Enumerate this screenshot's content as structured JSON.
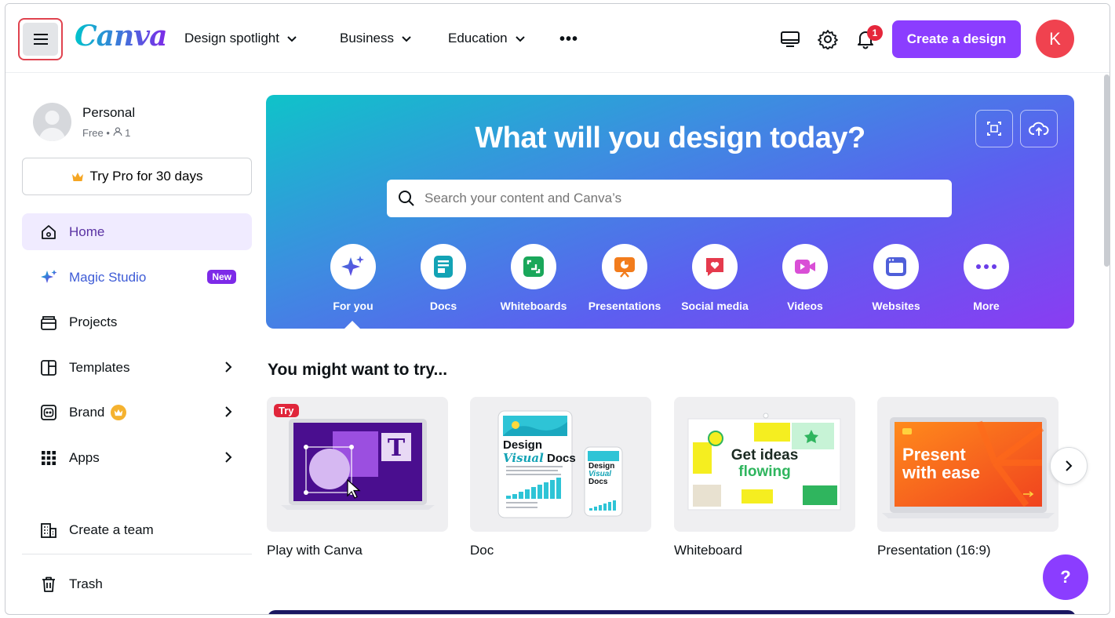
{
  "topbar": {
    "logo": "Canva",
    "nav": [
      {
        "label": "Design spotlight"
      },
      {
        "label": "Business"
      },
      {
        "label": "Education"
      }
    ],
    "notification_count": "1",
    "create_label": "Create a design",
    "avatar_initial": "K"
  },
  "sidebar": {
    "profile_name": "Personal",
    "profile_plan": "Free • ",
    "profile_members": "1",
    "try_pro_label": "Try Pro for 30 days",
    "items": [
      {
        "label": "Home"
      },
      {
        "label": "Magic Studio",
        "badge": "New"
      },
      {
        "label": "Projects"
      },
      {
        "label": "Templates"
      },
      {
        "label": "Brand"
      },
      {
        "label": "Apps"
      },
      {
        "label": "Create a team"
      },
      {
        "label": "Trash"
      }
    ]
  },
  "hero": {
    "title": "What will you design today?",
    "search_placeholder": "Search your content and Canva’s",
    "categories": [
      {
        "label": "For you"
      },
      {
        "label": "Docs"
      },
      {
        "label": "Whiteboards"
      },
      {
        "label": "Presentations"
      },
      {
        "label": "Social media"
      },
      {
        "label": "Videos"
      },
      {
        "label": "Websites"
      },
      {
        "label": "More"
      }
    ]
  },
  "suggestions": {
    "title": "You might want to try...",
    "cards": [
      {
        "label": "Play with Canva",
        "badge": "Try"
      },
      {
        "label": "Doc",
        "thumb_text": [
          "Design",
          "Visual",
          "Docs"
        ]
      },
      {
        "label": "Whiteboard",
        "thumb_text": [
          "Get ideas",
          "flowing"
        ]
      },
      {
        "label": "Presentation (16:9)",
        "thumb_text": [
          "Present",
          "with ease"
        ]
      }
    ]
  },
  "help_label": "?",
  "colors": {
    "accent": "#8b3dff",
    "active_bg": "#f0ebff",
    "badge_red": "#e5263b"
  }
}
